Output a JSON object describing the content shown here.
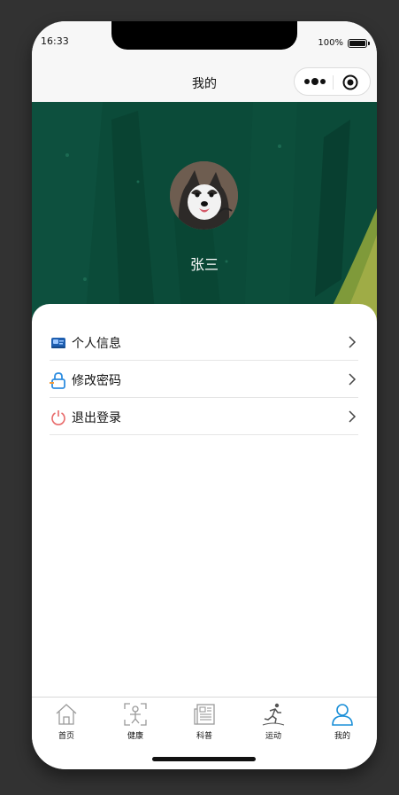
{
  "status_bar": {
    "time": "16:33",
    "battery": "100%"
  },
  "nav": {
    "title": "我的"
  },
  "profile": {
    "name": "张三"
  },
  "menu": [
    {
      "label": "个人信息",
      "icon": "id-card-icon"
    },
    {
      "label": "修改密码",
      "icon": "lock-icon"
    },
    {
      "label": "退出登录",
      "icon": "power-icon"
    }
  ],
  "tabs": [
    {
      "label": "首页",
      "icon": "home-icon",
      "active": false
    },
    {
      "label": "健康",
      "icon": "scan-person-icon",
      "active": false
    },
    {
      "label": "科普",
      "icon": "newspaper-icon",
      "active": false
    },
    {
      "label": "运动",
      "icon": "runner-icon",
      "active": false
    },
    {
      "label": "我的",
      "icon": "user-icon",
      "active": true
    }
  ],
  "colors": {
    "hero_green": "#0a4a38",
    "active_tab": "#1a8fd8",
    "lock_blue": "#2e8de0",
    "power_red": "#e86a6a"
  }
}
